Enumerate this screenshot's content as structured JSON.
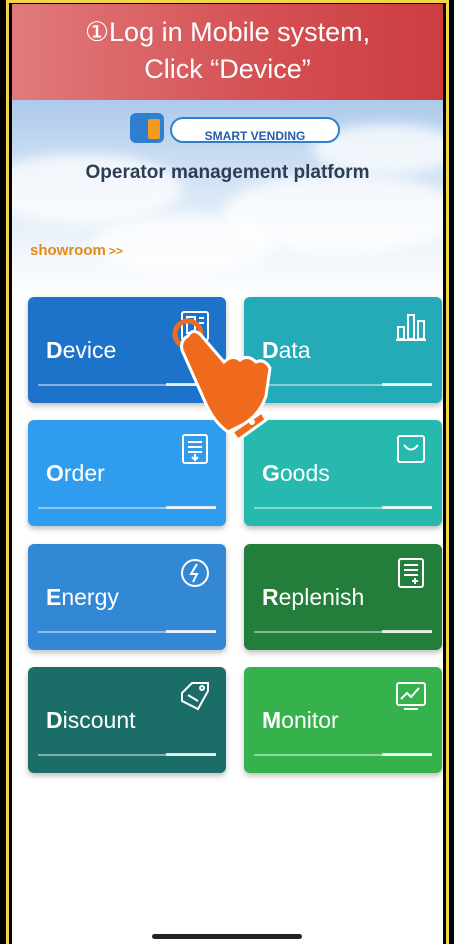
{
  "banner": {
    "line1": "①Log in Mobile system,",
    "line2": "Click “Device”"
  },
  "logo": {
    "tagline": "SMART VENDING"
  },
  "platform_title": "Operator management platform",
  "showroom": {
    "label": "showroom",
    "arrows": ">>"
  },
  "tiles": [
    {
      "first": "D",
      "rest": "evice",
      "icon": "device-icon",
      "color": "#1d72c9"
    },
    {
      "first": "D",
      "rest": "ata",
      "icon": "bar-chart-icon",
      "color": "#25aab8"
    },
    {
      "first": "O",
      "rest": "rder",
      "icon": "receipt-icon",
      "color": "#2f9cee"
    },
    {
      "first": "G",
      "rest": "oods",
      "icon": "basket-icon",
      "color": "#27b9ad"
    },
    {
      "first": "E",
      "rest": "nergy",
      "icon": "power-icon",
      "color": "#3388d6"
    },
    {
      "first": "R",
      "rest": "eplenish",
      "icon": "add-list-icon",
      "color": "#237d3b"
    },
    {
      "first": "D",
      "rest": "iscount",
      "icon": "tag-icon",
      "color": "#1b6e67"
    },
    {
      "first": "M",
      "rest": "onitor",
      "icon": "monitor-chart-icon",
      "color": "#35b24c"
    }
  ]
}
